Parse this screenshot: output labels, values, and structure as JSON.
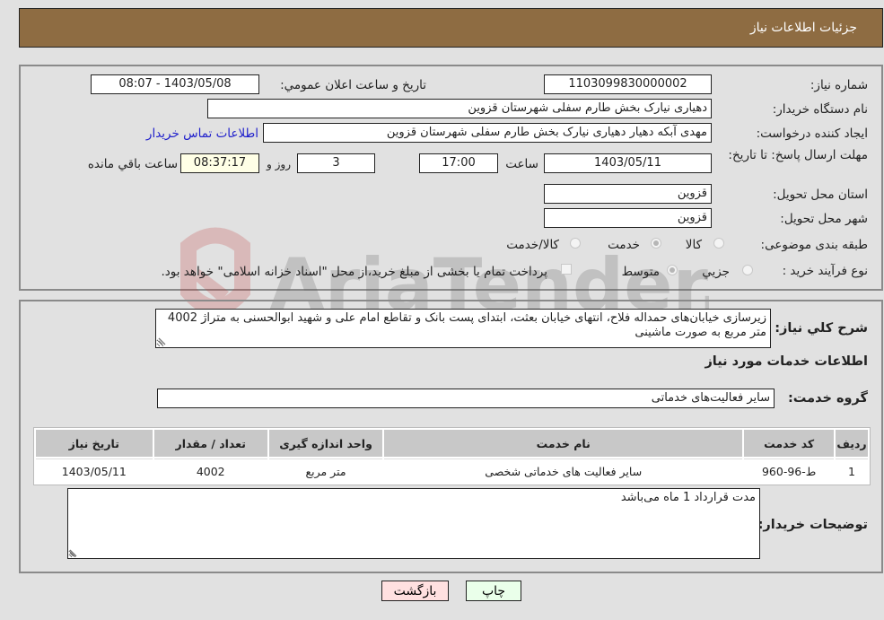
{
  "header": {
    "title": "جزئیات اطلاعات نیاز"
  },
  "form": {
    "need_number": {
      "label": "شماره نیاز:",
      "value": "1103099830000002"
    },
    "announce_datetime": {
      "label": "تاریخ و ساعت اعلان عمومي:",
      "value": "1403/05/08 - 08:07"
    },
    "buyer_org": {
      "label": "نام دستگاه خریدار:",
      "value": "دهیاری نیارک بخش طارم سفلی شهرستان قزوین"
    },
    "requester": {
      "label": "ایجاد کننده درخواست:",
      "value": "مهدی آبکه دهیار دهیاری نیارک بخش طارم سفلی شهرستان قزوین"
    },
    "buyer_contact_link": "اطلاعات تماس خریدار",
    "deadline": {
      "label": "مهلت ارسال پاسخ: تا تاریخ:",
      "date": "1403/05/11",
      "time_label": "ساعت",
      "time": "17:00",
      "days": "3",
      "days_label": "روز و",
      "remaining": "08:37:17",
      "remaining_label": "ساعت باقي مانده"
    },
    "delivery_province": {
      "label": "استان محل تحویل:",
      "value": "قزوین"
    },
    "delivery_city": {
      "label": "شهر محل تحویل:",
      "value": "قزوین"
    },
    "category": {
      "label": "طبقه بندی موضوعی:",
      "options": [
        "کالا",
        "خدمت",
        "کالا/خدمت"
      ],
      "selected": "خدمت"
    },
    "purchase_process": {
      "label": "نوع فرآیند خرید :",
      "options": [
        "جزيي",
        "متوسط"
      ],
      "selected": "متوسط",
      "treasury_note": "پرداخت تمام یا بخشی از مبلغ خرید،از محل \"اسناد خزانه اسلامی\" خواهد بود.",
      "treasury_checked": false
    }
  },
  "details": {
    "summary_label": "شرح کلي نياز:",
    "summary_text": "زیرسازی خیابان‌های حمداله فلاح، انتهای خیابان بعثت، ابتدای پست بانک و تقاطع امام علی و شهید ابوالحسنی  به متراژ 4002 متر مربع به صورت ماشینی",
    "services_heading": "اطلاعات خدمات مورد نیاز",
    "service_group_label": "گروه خدمت:",
    "service_group_value": "سایر فعالیت‌های خدماتی",
    "table": {
      "headers": [
        "ردیف",
        "کد خدمت",
        "نام خدمت",
        "واحد اندازه گیری",
        "تعداد / مقدار",
        "تاریخ نیاز"
      ],
      "rows": [
        [
          "1",
          "ط-96-960",
          "سایر فعالیت های خدماتی شخصی",
          "متر مربع",
          "4002",
          "1403/05/11"
        ]
      ]
    },
    "buyer_notes_label": "توضیحات خریدار:",
    "buyer_notes_text": "مدت قرارداد 1 ماه می‌باشد"
  },
  "buttons": {
    "print": "چاپ",
    "back": "بازگشت"
  },
  "watermark": {
    "text": "AriaTender.neT"
  },
  "colors": {
    "header_bg": "#8e6c42",
    "page_bg": "#e1e1e1",
    "link": "#2020cc",
    "back_btn": "#ffe0e0",
    "print_btn": "#eaffea"
  }
}
